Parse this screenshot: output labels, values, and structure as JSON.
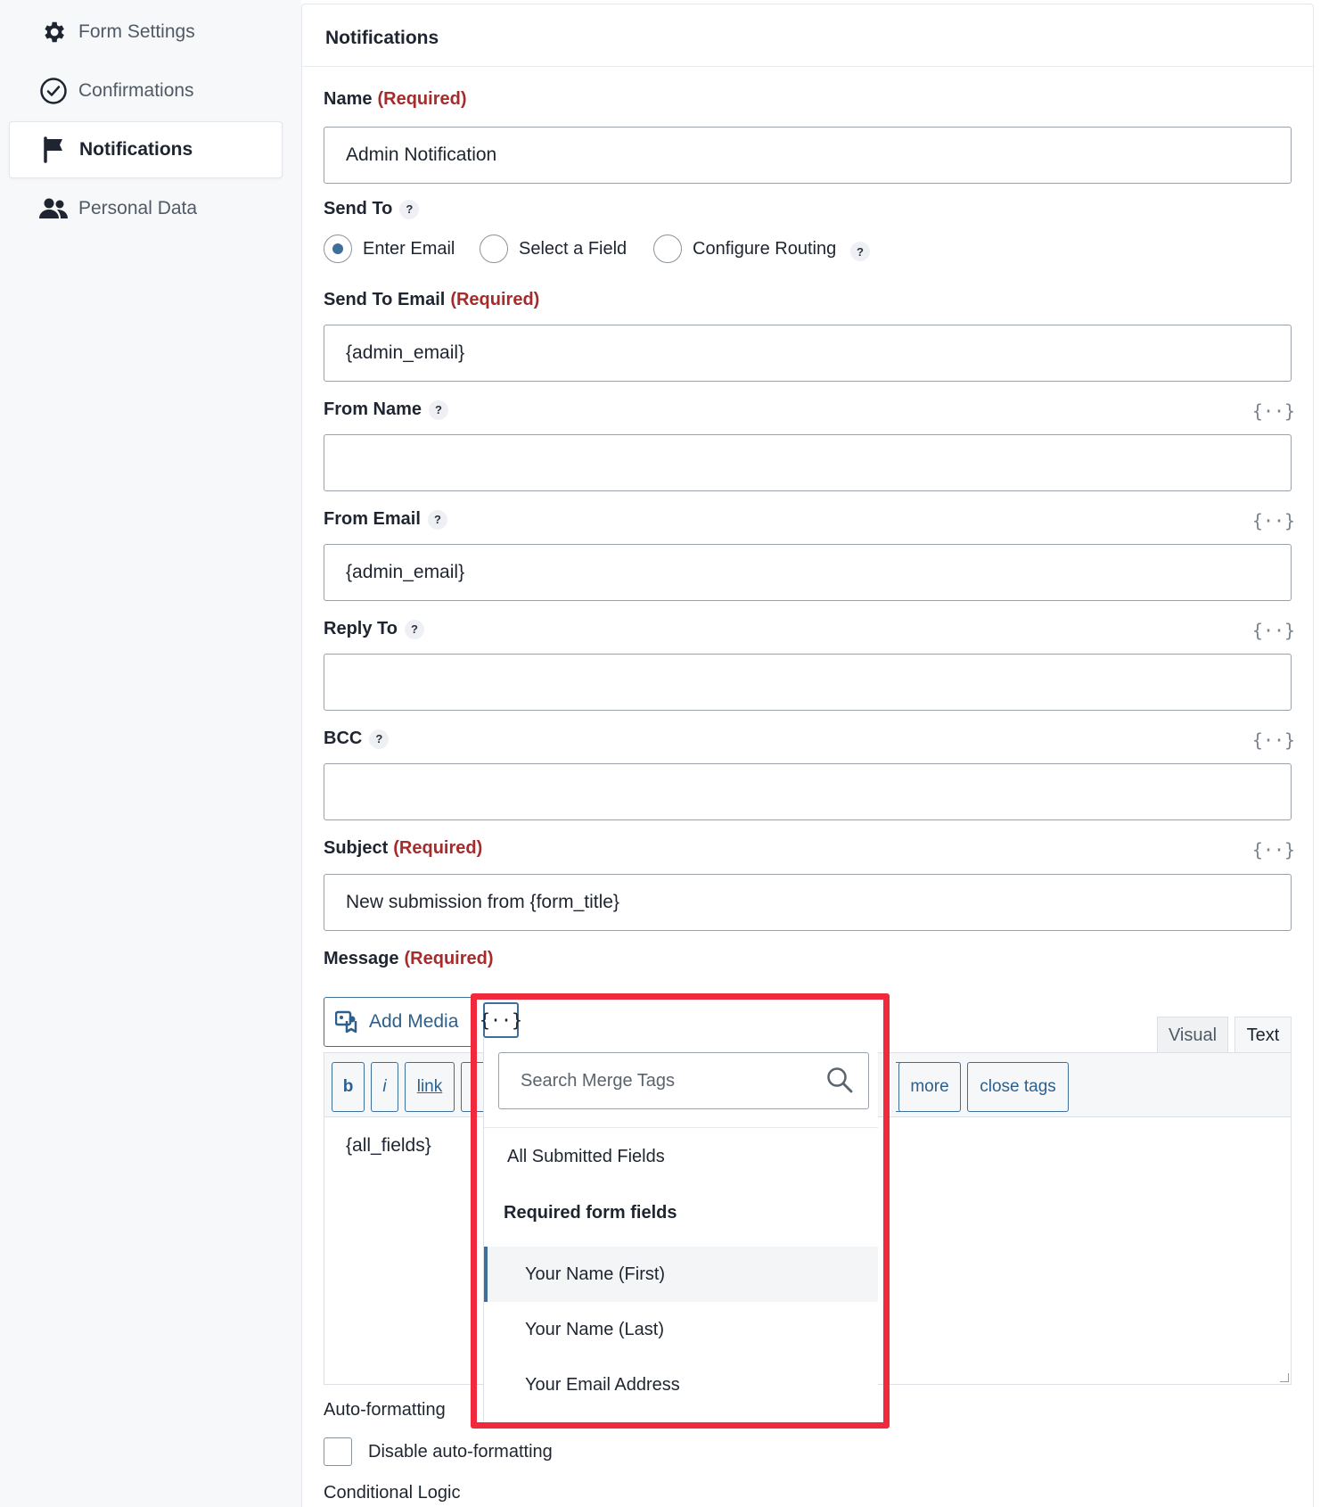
{
  "sidebar": {
    "items": [
      {
        "label": "Form Settings",
        "icon": "gear-icon"
      },
      {
        "label": "Confirmations",
        "icon": "check-circle-icon"
      },
      {
        "label": "Notifications",
        "icon": "flag-icon",
        "active": true
      },
      {
        "label": "Personal Data",
        "icon": "users-icon"
      }
    ]
  },
  "panel": {
    "title": "Notifications"
  },
  "required_text": "(Required)",
  "help_glyph": "?",
  "fields": {
    "name": {
      "label": "Name",
      "value": "Admin Notification"
    },
    "send_to": {
      "label": "Send To",
      "options": [
        "Enter Email",
        "Select a Field",
        "Configure Routing"
      ],
      "selected": "Enter Email"
    },
    "send_to_email": {
      "label": "Send To Email",
      "value": "{admin_email}"
    },
    "from_name": {
      "label": "From Name",
      "value": ""
    },
    "from_email": {
      "label": "From Email",
      "value": "{admin_email}"
    },
    "reply_to": {
      "label": "Reply To",
      "value": ""
    },
    "bcc": {
      "label": "BCC",
      "value": ""
    },
    "subject": {
      "label": "Subject",
      "value": "New submission from {form_title}"
    },
    "message": {
      "label": "Message",
      "value": "{all_fields}"
    }
  },
  "merge_tag_glyph": "{··}",
  "editor": {
    "add_media": "Add Media",
    "tabs": [
      "Visual",
      "Text"
    ],
    "toolbar": [
      "b",
      "i",
      "link",
      "more",
      "close tags"
    ]
  },
  "merge_dropdown": {
    "search_placeholder": "Search Merge Tags",
    "items": [
      {
        "label": "All Submitted Fields",
        "type": "item"
      },
      {
        "label": "Required form fields",
        "type": "group"
      },
      {
        "label": "Your Name (First)",
        "type": "sub",
        "active": true
      },
      {
        "label": "Your Name (Last)",
        "type": "sub"
      },
      {
        "label": "Your Email Address",
        "type": "sub"
      }
    ]
  },
  "auto_formatting": {
    "label": "Auto-formatting",
    "checkbox_label": "Disable auto-formatting",
    "checked": false
  },
  "conditional_logic": {
    "label": "Conditional Logic"
  },
  "colors": {
    "accent": "#3e6f99",
    "required": "#a62b2b",
    "highlight": "#f0293d"
  }
}
